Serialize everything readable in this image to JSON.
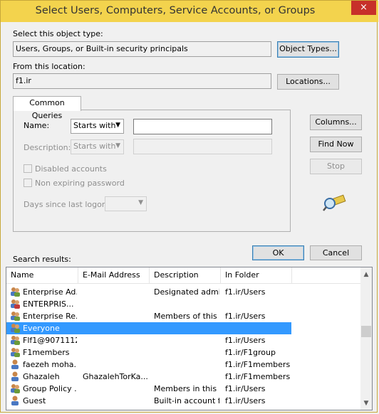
{
  "window": {
    "title": "Select Users, Computers, Service Accounts, or Groups",
    "close": "×"
  },
  "object_type": {
    "label": "Select this object type:",
    "value": "Users, Groups, or Built-in security principals",
    "button": "Object Types..."
  },
  "location": {
    "label": "From this location:",
    "value": "f1.ir",
    "button": "Locations..."
  },
  "tab": {
    "label": "Common Queries"
  },
  "query": {
    "name_label": "Name:",
    "name_mode": "Starts with",
    "desc_label": "Description:",
    "desc_mode": "Starts with",
    "disabled_accounts": "Disabled accounts",
    "non_expiring": "Non expiring password",
    "days_label": "Days since last logon:"
  },
  "side_buttons": {
    "columns": "Columns...",
    "find_now": "Find Now",
    "stop": "Stop"
  },
  "dialog_buttons": {
    "ok": "OK",
    "cancel": "Cancel"
  },
  "results": {
    "label": "Search results:",
    "columns": [
      "Name",
      "E-Mail Address",
      "Description",
      "In Folder"
    ],
    "rows": [
      {
        "name": "Enterprise Ad...",
        "email": "",
        "description": "Designated admi...",
        "folder": "f1.ir/Users",
        "icon": "group-icon"
      },
      {
        "name": "ENTERPRIS...",
        "email": "",
        "description": "",
        "folder": "",
        "icon": "special-group-icon"
      },
      {
        "name": "Enterprise Re...",
        "email": "",
        "description": "Members of this ...",
        "folder": "f1.ir/Users",
        "icon": "group-icon"
      },
      {
        "name": "Everyone",
        "email": "",
        "description": "",
        "folder": "",
        "icon": "group-icon",
        "selected": true
      },
      {
        "name": "Flf1@9071112",
        "email": "",
        "description": "",
        "folder": "f1.ir/Users",
        "icon": "group-icon"
      },
      {
        "name": "F1members",
        "email": "",
        "description": "",
        "folder": "f1.ir/F1group",
        "icon": "group-icon"
      },
      {
        "name": "faezeh moha...",
        "email": "",
        "description": "",
        "folder": "f1.ir/F1members",
        "icon": "user-icon"
      },
      {
        "name": "Ghazaleh",
        "email": "GhazalehTorKa...",
        "description": "",
        "folder": "f1.ir/F1members",
        "icon": "user-icon"
      },
      {
        "name": "Group Policy ...",
        "email": "",
        "description": "Members in this ...",
        "folder": "f1.ir/Users",
        "icon": "group-icon"
      },
      {
        "name": "Guest",
        "email": "",
        "description": "Built-in account f...",
        "folder": "f1.ir/Users",
        "icon": "user-icon"
      }
    ]
  },
  "colors": {
    "titlebar": "#f3d34d",
    "close": "#c7302a",
    "selection": "#3399ff"
  }
}
